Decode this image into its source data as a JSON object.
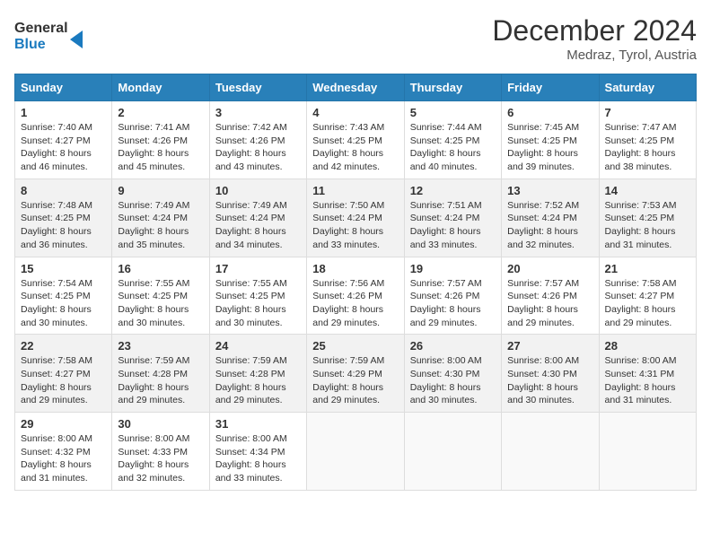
{
  "logo": {
    "line1": "General",
    "line2": "Blue"
  },
  "title": "December 2024",
  "location": "Medraz, Tyrol, Austria",
  "days_of_week": [
    "Sunday",
    "Monday",
    "Tuesday",
    "Wednesday",
    "Thursday",
    "Friday",
    "Saturday"
  ],
  "weeks": [
    [
      {
        "day": "1",
        "sunrise": "7:40 AM",
        "sunset": "4:27 PM",
        "daylight": "8 hours and 46 minutes."
      },
      {
        "day": "2",
        "sunrise": "7:41 AM",
        "sunset": "4:26 PM",
        "daylight": "8 hours and 45 minutes."
      },
      {
        "day": "3",
        "sunrise": "7:42 AM",
        "sunset": "4:26 PM",
        "daylight": "8 hours and 43 minutes."
      },
      {
        "day": "4",
        "sunrise": "7:43 AM",
        "sunset": "4:25 PM",
        "daylight": "8 hours and 42 minutes."
      },
      {
        "day": "5",
        "sunrise": "7:44 AM",
        "sunset": "4:25 PM",
        "daylight": "8 hours and 40 minutes."
      },
      {
        "day": "6",
        "sunrise": "7:45 AM",
        "sunset": "4:25 PM",
        "daylight": "8 hours and 39 minutes."
      },
      {
        "day": "7",
        "sunrise": "7:47 AM",
        "sunset": "4:25 PM",
        "daylight": "8 hours and 38 minutes."
      }
    ],
    [
      {
        "day": "8",
        "sunrise": "7:48 AM",
        "sunset": "4:25 PM",
        "daylight": "8 hours and 36 minutes."
      },
      {
        "day": "9",
        "sunrise": "7:49 AM",
        "sunset": "4:24 PM",
        "daylight": "8 hours and 35 minutes."
      },
      {
        "day": "10",
        "sunrise": "7:49 AM",
        "sunset": "4:24 PM",
        "daylight": "8 hours and 34 minutes."
      },
      {
        "day": "11",
        "sunrise": "7:50 AM",
        "sunset": "4:24 PM",
        "daylight": "8 hours and 33 minutes."
      },
      {
        "day": "12",
        "sunrise": "7:51 AM",
        "sunset": "4:24 PM",
        "daylight": "8 hours and 33 minutes."
      },
      {
        "day": "13",
        "sunrise": "7:52 AM",
        "sunset": "4:24 PM",
        "daylight": "8 hours and 32 minutes."
      },
      {
        "day": "14",
        "sunrise": "7:53 AM",
        "sunset": "4:25 PM",
        "daylight": "8 hours and 31 minutes."
      }
    ],
    [
      {
        "day": "15",
        "sunrise": "7:54 AM",
        "sunset": "4:25 PM",
        "daylight": "8 hours and 30 minutes."
      },
      {
        "day": "16",
        "sunrise": "7:55 AM",
        "sunset": "4:25 PM",
        "daylight": "8 hours and 30 minutes."
      },
      {
        "day": "17",
        "sunrise": "7:55 AM",
        "sunset": "4:25 PM",
        "daylight": "8 hours and 30 minutes."
      },
      {
        "day": "18",
        "sunrise": "7:56 AM",
        "sunset": "4:26 PM",
        "daylight": "8 hours and 29 minutes."
      },
      {
        "day": "19",
        "sunrise": "7:57 AM",
        "sunset": "4:26 PM",
        "daylight": "8 hours and 29 minutes."
      },
      {
        "day": "20",
        "sunrise": "7:57 AM",
        "sunset": "4:26 PM",
        "daylight": "8 hours and 29 minutes."
      },
      {
        "day": "21",
        "sunrise": "7:58 AM",
        "sunset": "4:27 PM",
        "daylight": "8 hours and 29 minutes."
      }
    ],
    [
      {
        "day": "22",
        "sunrise": "7:58 AM",
        "sunset": "4:27 PM",
        "daylight": "8 hours and 29 minutes."
      },
      {
        "day": "23",
        "sunrise": "7:59 AM",
        "sunset": "4:28 PM",
        "daylight": "8 hours and 29 minutes."
      },
      {
        "day": "24",
        "sunrise": "7:59 AM",
        "sunset": "4:28 PM",
        "daylight": "8 hours and 29 minutes."
      },
      {
        "day": "25",
        "sunrise": "7:59 AM",
        "sunset": "4:29 PM",
        "daylight": "8 hours and 29 minutes."
      },
      {
        "day": "26",
        "sunrise": "8:00 AM",
        "sunset": "4:30 PM",
        "daylight": "8 hours and 30 minutes."
      },
      {
        "day": "27",
        "sunrise": "8:00 AM",
        "sunset": "4:30 PM",
        "daylight": "8 hours and 30 minutes."
      },
      {
        "day": "28",
        "sunrise": "8:00 AM",
        "sunset": "4:31 PM",
        "daylight": "8 hours and 31 minutes."
      }
    ],
    [
      {
        "day": "29",
        "sunrise": "8:00 AM",
        "sunset": "4:32 PM",
        "daylight": "8 hours and 31 minutes."
      },
      {
        "day": "30",
        "sunrise": "8:00 AM",
        "sunset": "4:33 PM",
        "daylight": "8 hours and 32 minutes."
      },
      {
        "day": "31",
        "sunrise": "8:00 AM",
        "sunset": "4:34 PM",
        "daylight": "8 hours and 33 minutes."
      },
      null,
      null,
      null,
      null
    ]
  ],
  "labels": {
    "sunrise": "Sunrise:",
    "sunset": "Sunset:",
    "daylight": "Daylight:"
  }
}
